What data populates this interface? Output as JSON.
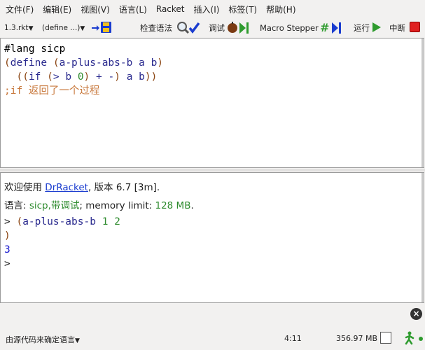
{
  "menu": [
    "文件(F)",
    "编辑(E)",
    "视图(V)",
    "语言(L)",
    "Racket",
    "插入(I)",
    "标签(T)",
    "帮助(H)"
  ],
  "toolbar": {
    "file_selector": "1.3.rkt",
    "define_selector": "(define ...)",
    "check_syntax": "检查语法",
    "debug": "调试",
    "macro_stepper": "Macro Stepper",
    "run": "运行",
    "stop": "中断"
  },
  "definitions": {
    "line1": "#lang sicp",
    "comment": ";if 返回了一个过程"
  },
  "interactions": {
    "welcome_prefix": "欢迎使用 ",
    "welcome_link": "DrRacket",
    "welcome_suffix": ", 版本 6.7 [3m].",
    "lang_label": "语言: ",
    "lang_value": "sicp,带调试",
    "mem_label": "; memory limit: ",
    "mem_value": "128 MB",
    "mem_end": ".",
    "prompt": ">",
    "result": "3"
  },
  "status": {
    "language": "由源代码来确定语言",
    "position": "4:11",
    "memory": "356.97 MB"
  },
  "colors": {
    "paren": "#8b4513",
    "identifier": "#2b2b8f",
    "number": "#2e8b2e",
    "comment": "#c8783c",
    "link": "#1a3ccf",
    "stop": "#e02020"
  }
}
